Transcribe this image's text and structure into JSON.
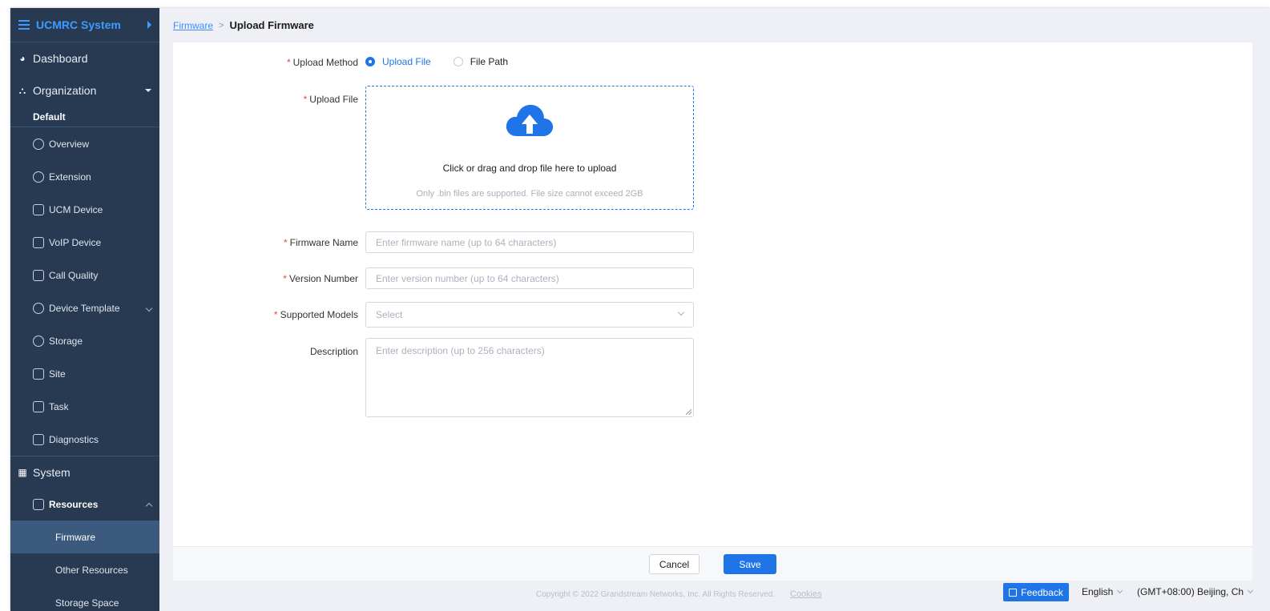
{
  "sidebar": {
    "brand": "UCMRC System",
    "dashboard": "Dashboard",
    "organization": "Organization",
    "org_default": "Default",
    "org_items": [
      {
        "label": "Overview",
        "icon": "overview-icon"
      },
      {
        "label": "Extension",
        "icon": "user-icon"
      },
      {
        "label": "UCM Device",
        "icon": "server-icon"
      },
      {
        "label": "VoIP Device",
        "icon": "phone-icon"
      },
      {
        "label": "Call Quality",
        "icon": "chart-icon"
      },
      {
        "label": "Device Template",
        "icon": "gear-icon"
      },
      {
        "label": "Storage",
        "icon": "database-icon"
      },
      {
        "label": "Site",
        "icon": "site-icon"
      },
      {
        "label": "Task",
        "icon": "task-icon"
      },
      {
        "label": "Diagnostics",
        "icon": "diagnostics-icon"
      }
    ],
    "system": "System",
    "resources": "Resources",
    "resource_items": [
      "Firmware",
      "Other Resources",
      "Storage Space"
    ]
  },
  "breadcrumb": {
    "parent": "Firmware",
    "separator": ">",
    "current": "Upload Firmware"
  },
  "form": {
    "upload_method": {
      "label": "Upload Method",
      "options": [
        "Upload File",
        "File Path"
      ],
      "selected": "Upload File"
    },
    "upload_file": {
      "label": "Upload File",
      "main_text": "Click or drag and drop file here to upload",
      "hint": "Only .bin files are supported. File size cannot exceed 2GB"
    },
    "firmware_name": {
      "label": "Firmware Name",
      "placeholder": "Enter firmware name (up to 64 characters)"
    },
    "version_number": {
      "label": "Version Number",
      "placeholder": "Enter version number (up to 64 characters)"
    },
    "supported_models": {
      "label": "Supported Models",
      "placeholder": "Select"
    },
    "description": {
      "label": "Description",
      "placeholder": "Enter description (up to 256 characters)"
    },
    "required_mark": "*"
  },
  "actions": {
    "cancel": "Cancel",
    "save": "Save"
  },
  "footer": {
    "copyright": "Copyright © 2022 Grandstream Networks, Inc. All Rights Reserved.",
    "cookies": "Cookies",
    "feedback": "Feedback",
    "language": "English",
    "timezone": "(GMT+08:00) Beijing, Ch"
  },
  "colors": {
    "sidebar_bg": "#273a52",
    "accent": "#1f75e8",
    "required": "#f0433a"
  }
}
